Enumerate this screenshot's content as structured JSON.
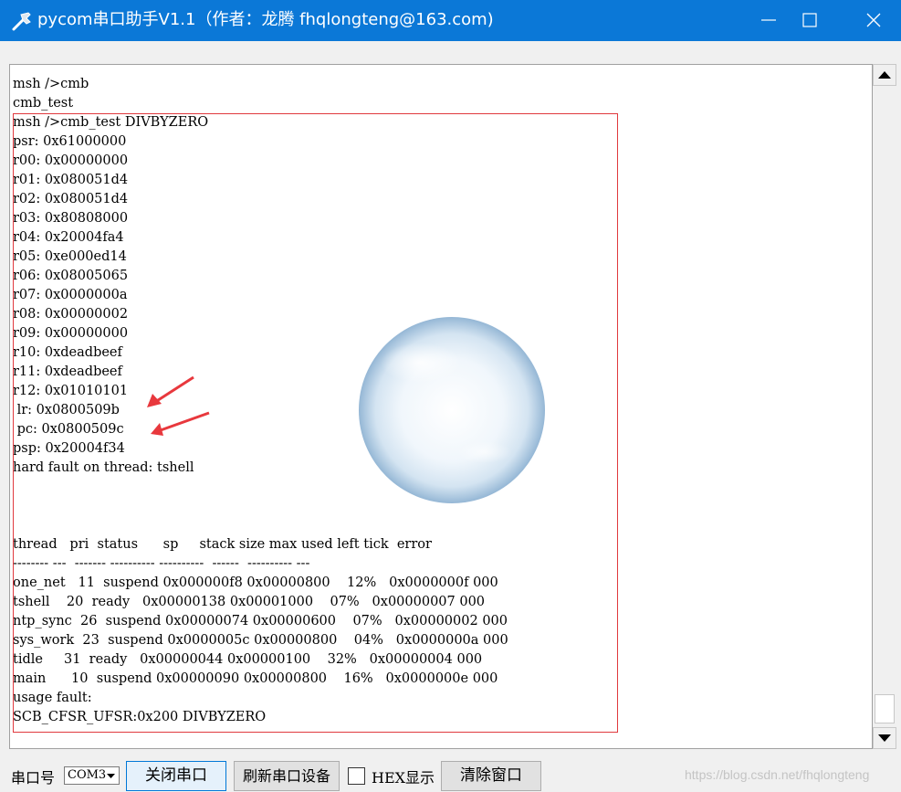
{
  "window": {
    "title": "pycom串口助手V1.1（作者：龙腾 fhqlongteng@163.com)",
    "title_bar_color": "#0b78d7"
  },
  "terminal": {
    "lines": [
      "msh />cmb",
      "cmb_test",
      "msh />cmb_test DIVBYZERO",
      "psr: 0x61000000",
      "r00: 0x00000000",
      "r01: 0x080051d4",
      "r02: 0x080051d4",
      "r03: 0x80808000",
      "r04: 0x20004fa4",
      "r05: 0xe000ed14",
      "r06: 0x08005065",
      "r07: 0x0000000a",
      "r08: 0x00000002",
      "r09: 0x00000000",
      "r10: 0xdeadbeef",
      "r11: 0xdeadbeef",
      "r12: 0x01010101",
      " lr: 0x0800509b",
      " pc: 0x0800509c",
      "psp: 0x20004f34",
      "hard fault on thread: tshell",
      "",
      "",
      "",
      "thread   pri  status      sp     stack size max used left tick  error",
      "-------- ---  ------- ---------- ----------  ------  ---------- ---",
      "one_net   11  suspend 0x000000f8 0x00000800    12%   0x0000000f 000",
      "tshell    20  ready   0x00000138 0x00001000    07%   0x00000007 000",
      "ntp_sync  26  suspend 0x00000074 0x00000600    07%   0x00000002 000",
      "sys_work  23  suspend 0x0000005c 0x00000800    04%   0x0000000a 000",
      "tidle     31  ready   0x00000044 0x00000100    32%   0x00000004 000",
      "main      10  suspend 0x00000090 0x00000800    16%   0x0000000e 000",
      "usage fault:",
      "SCB_CFSR_UFSR:0x200 DIVBYZERO",
      ""
    ],
    "highlight_color": "#e0393e"
  },
  "controls": {
    "port_label": "串口号",
    "port_value": "COM3",
    "close_port_button": "关闭串口",
    "refresh_button": "刷新串口设备",
    "hex_label": "HEX显示",
    "clear_button": "清除窗口"
  },
  "watermark": "https://blog.csdn.net/fhqlongteng",
  "icons": [
    "app-icon",
    "minimize-icon",
    "maximize-icon",
    "close-icon",
    "scroll-up-icon",
    "scroll-down-icon",
    "dropdown-caret-icon",
    "bubble-image",
    "red-arrow-icon"
  ]
}
